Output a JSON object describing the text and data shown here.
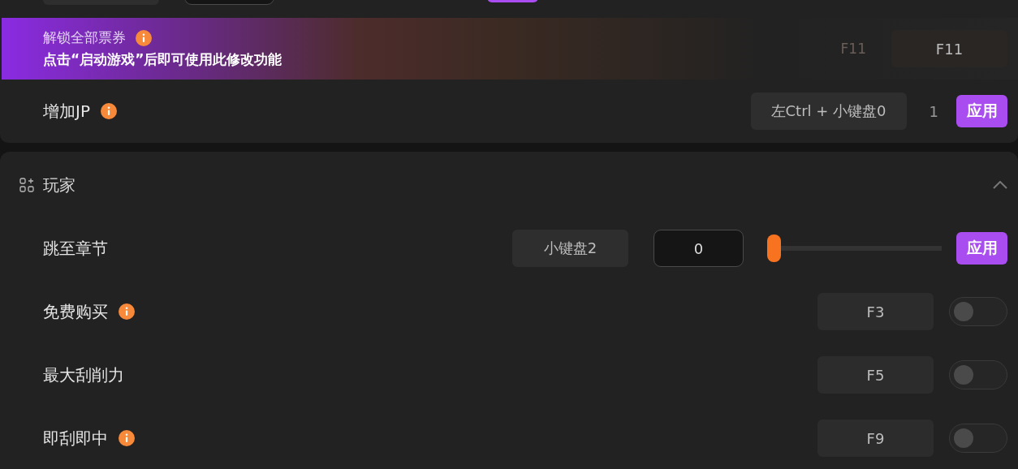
{
  "banner": {
    "title": "解锁全部票券",
    "info": true,
    "message": "点击“启动游戏”后即可使用此修改功能",
    "faded_key": "F11",
    "hotkey": "F11"
  },
  "jp_row": {
    "label": "增加JP",
    "info": true,
    "hotkey": "左Ctrl + 小键盘0",
    "value": "1",
    "button": "应用"
  },
  "section": {
    "title": "玩家",
    "expanded": true,
    "rows": [
      {
        "kind": "slider",
        "label": "跳至章节",
        "info": false,
        "hotkey": "小键盘2",
        "value": "0",
        "level": 0,
        "button": "应用"
      },
      {
        "kind": "toggle",
        "label": "免费购买",
        "info": true,
        "hotkey": "F3",
        "on": false
      },
      {
        "kind": "toggle",
        "label": "最大刮削力",
        "info": false,
        "hotkey": "F5",
        "on": false
      },
      {
        "kind": "toggle",
        "label": "即刮即中",
        "info": true,
        "hotkey": "F9",
        "on": false
      }
    ]
  }
}
